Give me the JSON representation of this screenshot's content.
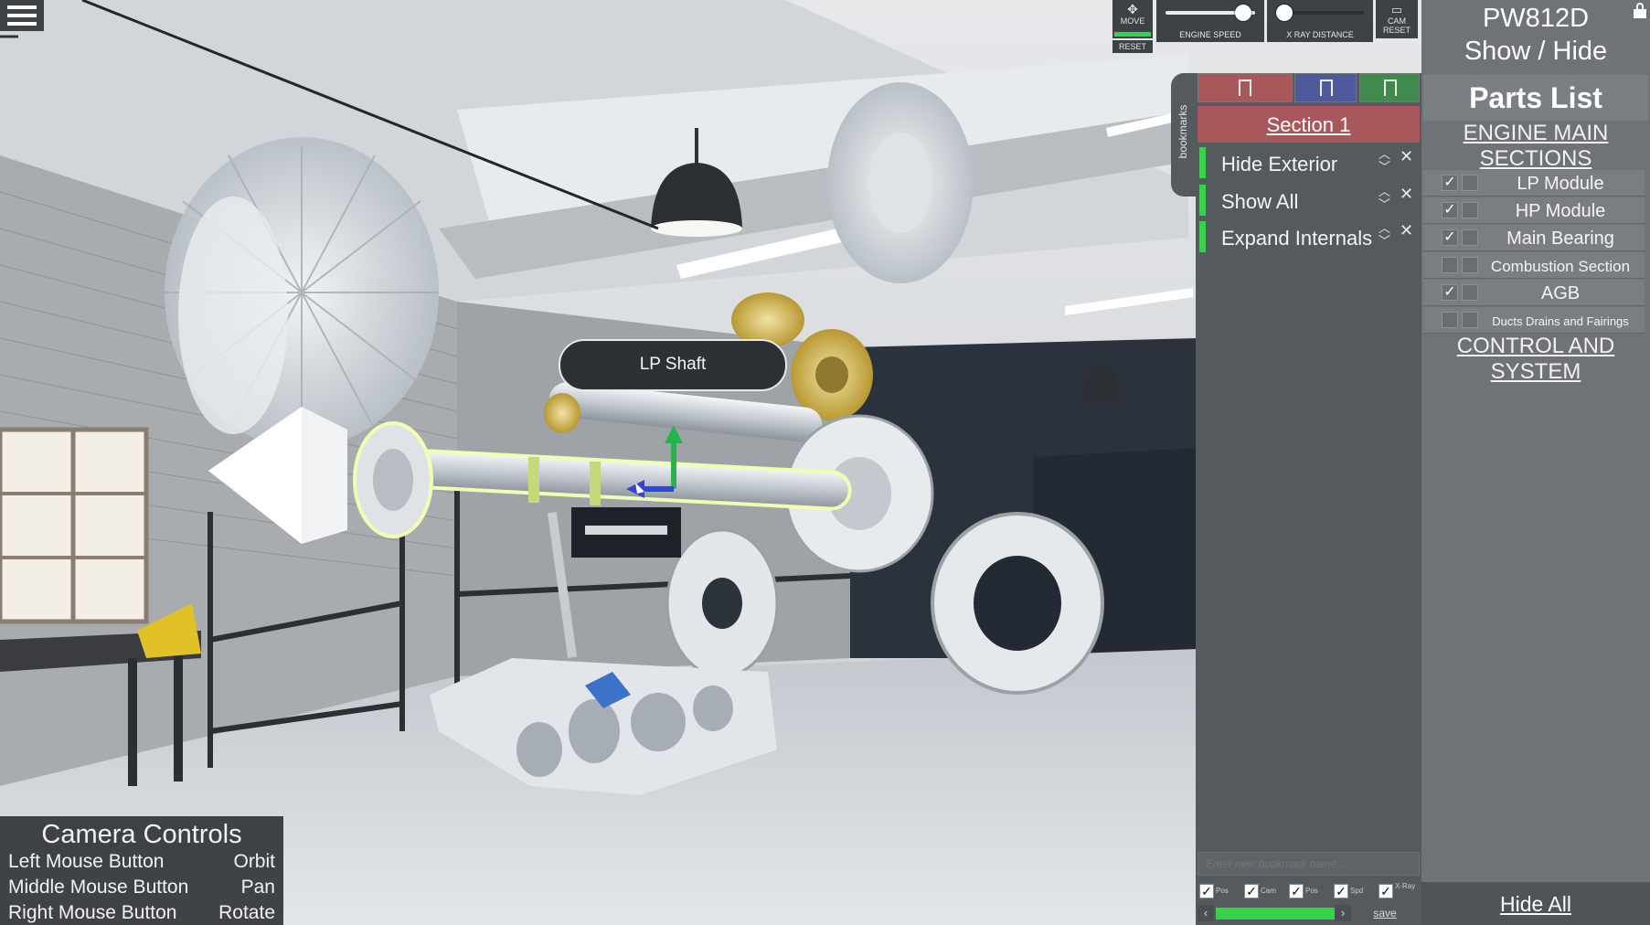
{
  "toolbar": {
    "move_label": "MOVE",
    "reset_label": "RESET",
    "engine_speed_label": "ENGINE SPEED",
    "engine_speed_level": 0.95,
    "xray_distance_label": "X RAY DISTANCE",
    "xray_distance_level": 0.0,
    "cam_reset_label": "CAM RESET"
  },
  "tooltip": {
    "label": "LP Shaft"
  },
  "bookmarks": {
    "side_label": "bookmarks",
    "section_title": "Section 1",
    "items": [
      {
        "label": "Hide Exterior"
      },
      {
        "label": "Show All"
      },
      {
        "label": "Expand Internals"
      }
    ],
    "new_name_placeholder": "Enter new bookmark name...",
    "options": [
      {
        "label": "Pos",
        "checked": true
      },
      {
        "label": "Cam",
        "checked": true
      },
      {
        "label": "Pos",
        "checked": true
      },
      {
        "label": "Spd",
        "checked": true
      },
      {
        "label": "X-Ray",
        "checked": true
      }
    ],
    "save_label": "save",
    "tab_colors": [
      "#a8585a",
      "#4e5a9c",
      "#3f8a4c"
    ]
  },
  "parts_panel": {
    "model": "PW812D",
    "subtitle": "Show / Hide",
    "title": "Parts List",
    "group_engine": "ENGINE MAIN SECTIONS",
    "parts": [
      {
        "label": "LP Module",
        "checked": true
      },
      {
        "label": "HP Module",
        "checked": true
      },
      {
        "label": "Main Bearing",
        "checked": true
      },
      {
        "label": "Combustion Section",
        "checked": false
      },
      {
        "label": "AGB",
        "checked": true
      },
      {
        "label": "Ducts Drains and Fairings",
        "checked": false
      }
    ],
    "group_control": "CONTROL AND SYSTEM",
    "hide_all_label": "Hide All"
  },
  "camera_controls": {
    "title": "Camera Controls",
    "rows": [
      {
        "button": "Left Mouse Button",
        "action": "Orbit"
      },
      {
        "button": "Middle Mouse Button",
        "action": "Pan"
      },
      {
        "button": "Right Mouse Button",
        "action": "Rotate"
      }
    ]
  },
  "colors": {
    "accent_green": "#35d24a",
    "panel_dark": "#555a5e",
    "panel_light": "#6f7377",
    "highlight_outline": "#f0ffb0"
  }
}
